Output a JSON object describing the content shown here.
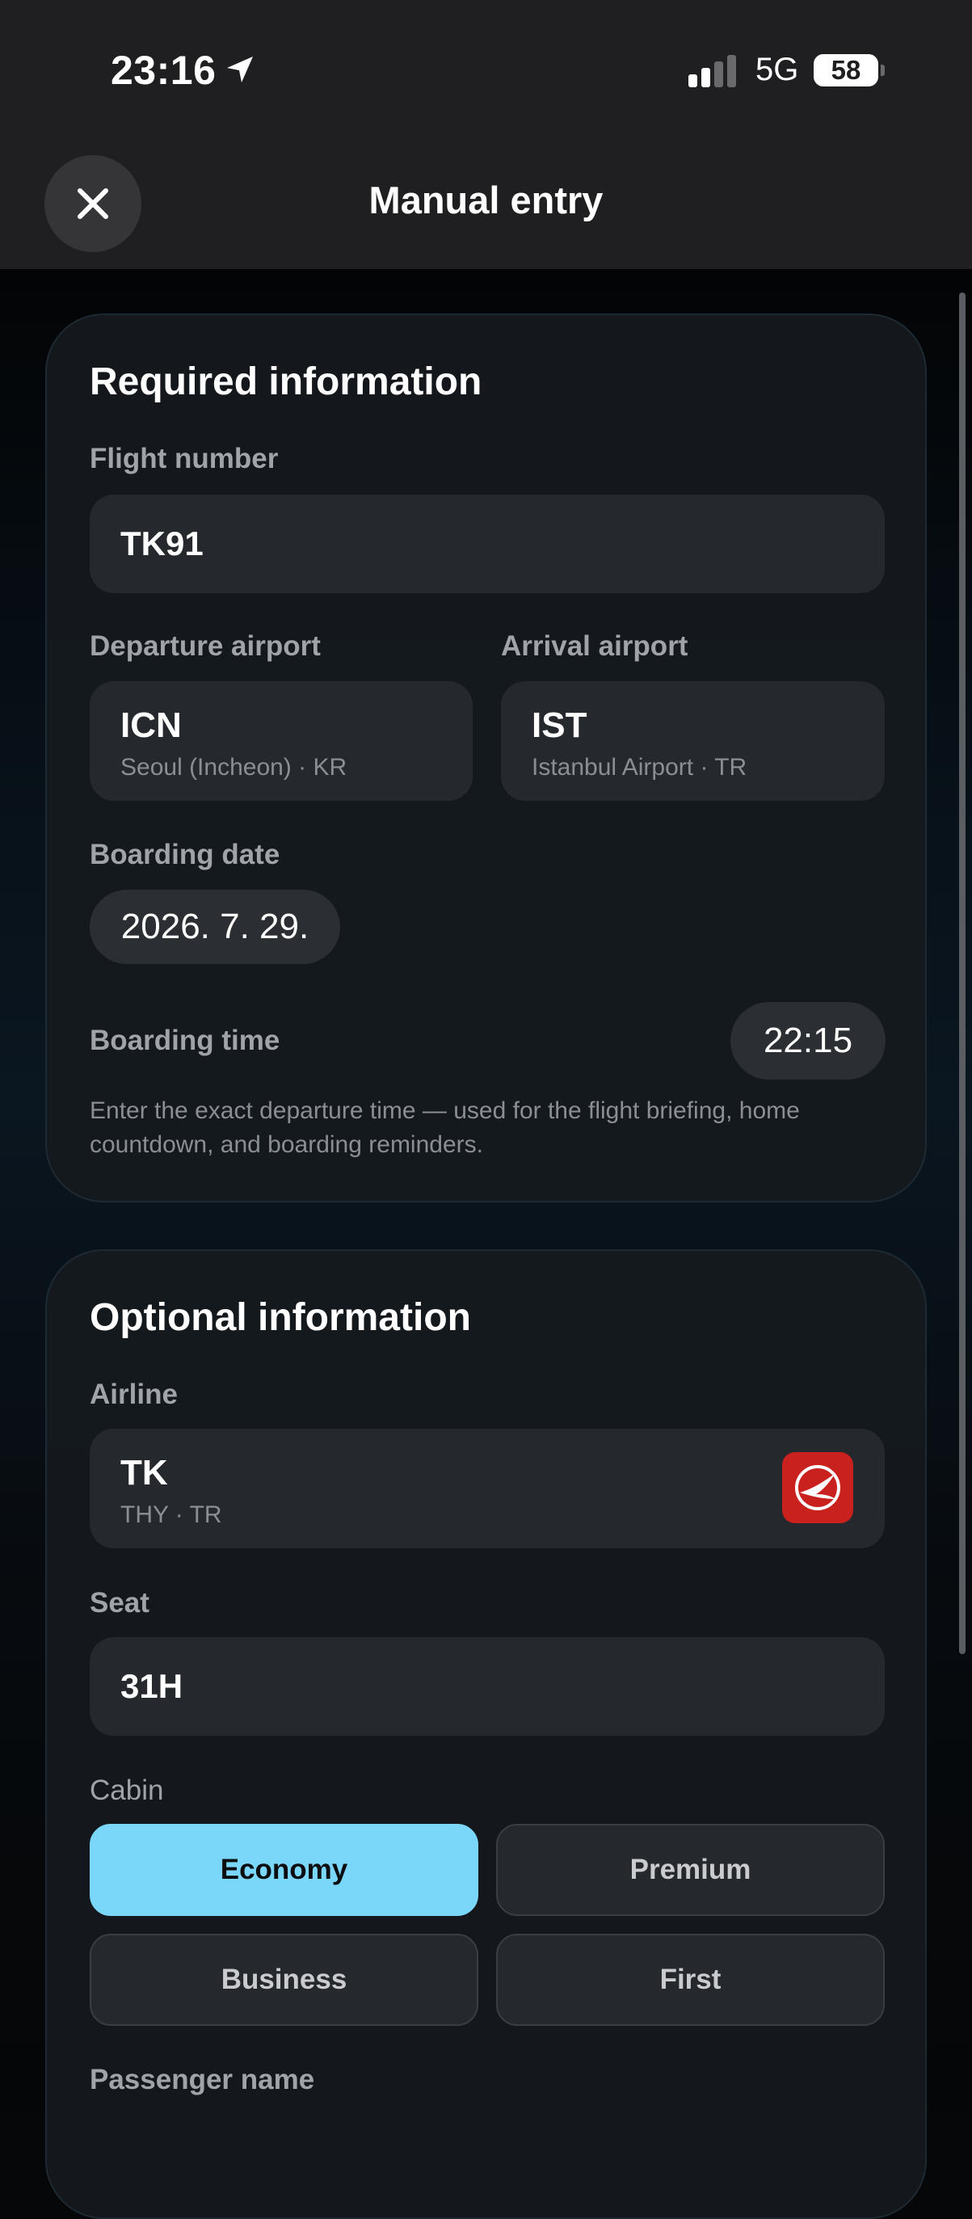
{
  "status_bar": {
    "time": "23:16",
    "network": "5G",
    "battery": "58",
    "location_icon": "location-arrow-icon",
    "signal_icon": "cellular-signal-icon"
  },
  "header": {
    "title": "Manual entry",
    "close_icon": "close-icon"
  },
  "required": {
    "title": "Required information",
    "flight_number": {
      "label": "Flight number",
      "value": "TK91"
    },
    "departure": {
      "label": "Departure airport",
      "code": "ICN",
      "name": "Seoul (Incheon) · KR"
    },
    "arrival": {
      "label": "Arrival airport",
      "code": "IST",
      "name": "Istanbul Airport · TR"
    },
    "boarding_date": {
      "label": "Boarding date",
      "value": "2026. 7. 29."
    },
    "boarding_time": {
      "label": "Boarding time",
      "value": "22:15"
    },
    "help": "Enter the exact departure time — used for the flight briefing, home countdown, and boarding reminders."
  },
  "optional": {
    "title": "Optional information",
    "airline": {
      "label": "Airline",
      "code": "TK",
      "name": "THY · TR",
      "logo_icon": "turkish-airlines-logo-icon",
      "logo_color": "#c8211e"
    },
    "seat": {
      "label": "Seat",
      "value": "31H"
    },
    "cabin": {
      "label": "Cabin",
      "options": [
        "Economy",
        "Premium",
        "Business",
        "First"
      ],
      "selected": "Economy",
      "accent_color": "#7ad7fa"
    },
    "passenger_name": {
      "label": "Passenger name"
    }
  }
}
